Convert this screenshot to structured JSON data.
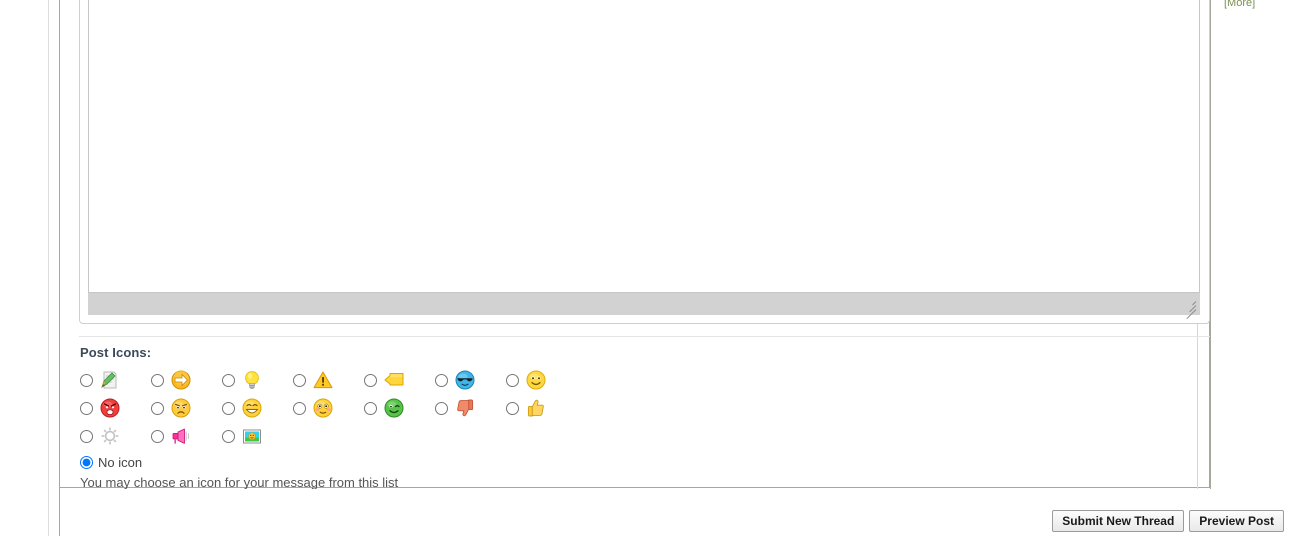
{
  "editor": {
    "message_value": "",
    "message_placeholder": "",
    "resize_grip_title": "Drag to resize"
  },
  "sidebar": {
    "more_link": "[More]"
  },
  "post_icons": {
    "title": "Post Icons:",
    "help_text": "You may choose an icon for your message from this list",
    "no_icon_label": "No icon",
    "no_icon_selected": true,
    "rows": [
      [
        {
          "name": "notepad-pencil-icon",
          "glyph": "📝",
          "selected": false
        },
        {
          "name": "arrow-right-icon",
          "glyph": "➡",
          "selected": false
        },
        {
          "name": "lightbulb-icon",
          "glyph": "💡",
          "selected": false
        },
        {
          "name": "warning-triangle-icon",
          "glyph": "⚠",
          "selected": false
        },
        {
          "name": "speech-bubble-icon",
          "glyph": "💬",
          "selected": false
        },
        {
          "name": "cool-sunglasses-face-icon",
          "glyph": "😎",
          "selected": false
        },
        {
          "name": "smiley-face-icon",
          "glyph": "🙂",
          "selected": false
        }
      ],
      [
        {
          "name": "angry-face-icon",
          "glyph": "😡",
          "selected": false
        },
        {
          "name": "sad-face-icon",
          "glyph": "😟",
          "selected": false
        },
        {
          "name": "grinning-face-icon",
          "glyph": "😁",
          "selected": false
        },
        {
          "name": "embarrassed-face-icon",
          "glyph": "😳",
          "selected": false
        },
        {
          "name": "winking-face-icon",
          "glyph": "😉",
          "selected": false
        },
        {
          "name": "thumbs-down-icon",
          "glyph": "👎",
          "selected": false
        },
        {
          "name": "thumbs-up-icon",
          "glyph": "👍",
          "selected": false
        }
      ],
      [
        {
          "name": "gear-icon",
          "glyph": "⚙",
          "selected": false
        },
        {
          "name": "megaphone-icon",
          "glyph": "📣",
          "selected": false
        },
        {
          "name": "picture-icon",
          "glyph": "🖼",
          "selected": false
        }
      ]
    ]
  },
  "actions": {
    "submit_label": "Submit New Thread",
    "preview_label": "Preview Post"
  },
  "colors": {
    "panel_border": "#a8a79c",
    "editor_border": "#cfcfcf",
    "statusbar": "#d2d2d2",
    "title": "#3b4a5a",
    "more_link": "#7b8f51",
    "button_border": "#9b9b9b"
  }
}
